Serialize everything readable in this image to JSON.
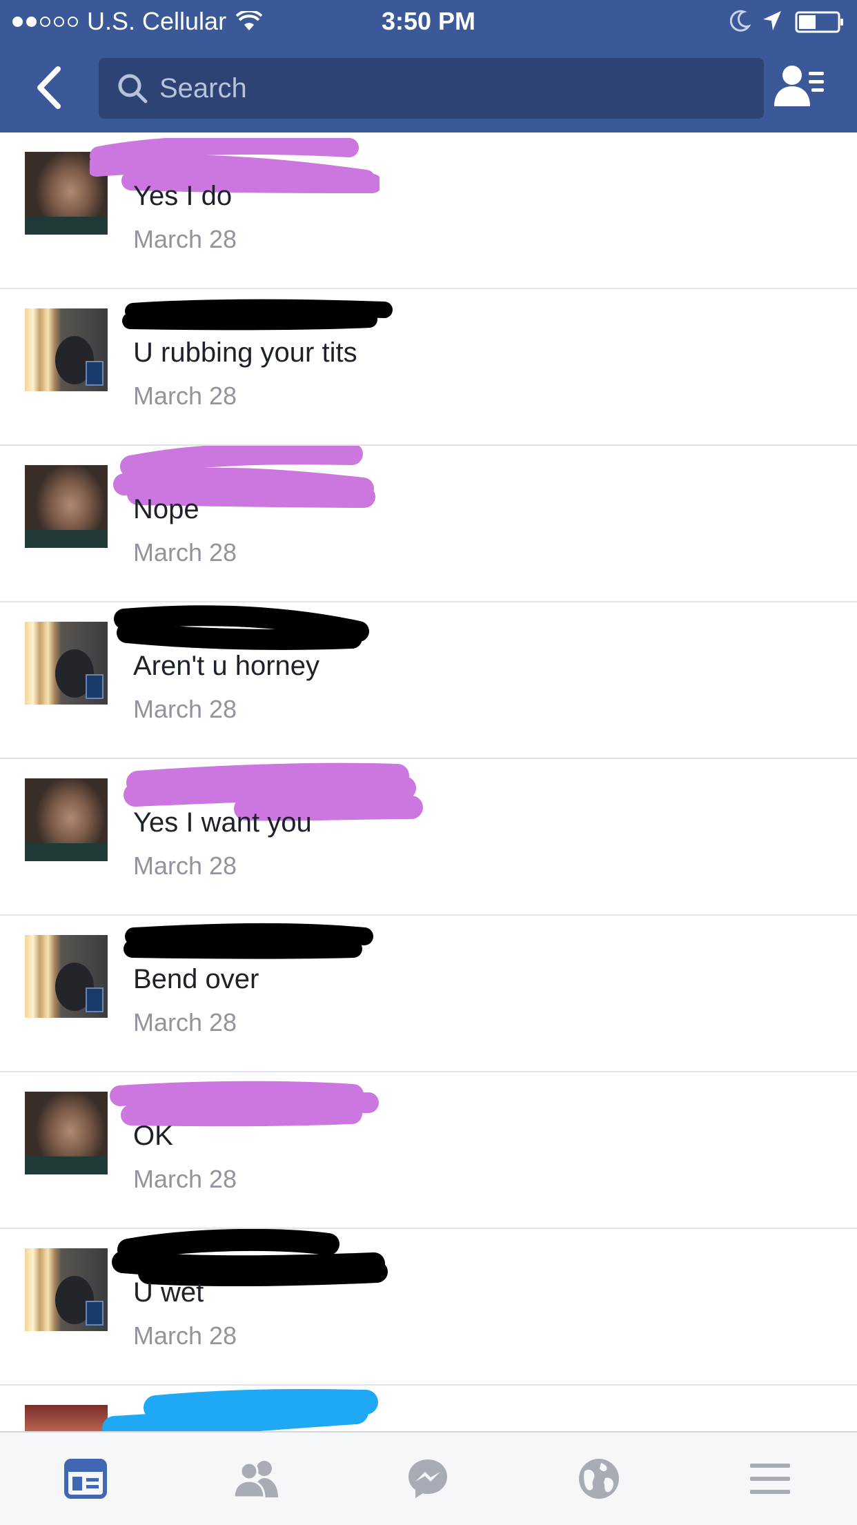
{
  "status_bar": {
    "carrier": "U.S. Cellular",
    "time": "3:50 PM",
    "signal_bars_filled": 2,
    "signal_bars_total": 5,
    "battery_level": 0.45
  },
  "nav": {
    "back_icon": "chevron-left-icon",
    "search_placeholder": "Search",
    "search_value": "",
    "right_icon": "friends-settings-icon"
  },
  "results": [
    {
      "avatar": "woman",
      "message": "Yes I do",
      "date": "March 28",
      "redaction_color": "#cc77e0"
    },
    {
      "avatar": "man",
      "message": "U rubbing your tits",
      "date": "March 28",
      "redaction_color": "#000000"
    },
    {
      "avatar": "woman",
      "message": "Nope",
      "date": "March 28",
      "redaction_color": "#cc77e0"
    },
    {
      "avatar": "man",
      "message": "Aren't u horney",
      "date": "March 28",
      "redaction_color": "#000000"
    },
    {
      "avatar": "woman",
      "message": "Yes I want you",
      "date": "March 28",
      "redaction_color": "#cc77e0"
    },
    {
      "avatar": "man",
      "message": "Bend over",
      "date": "March 28",
      "redaction_color": "#000000"
    },
    {
      "avatar": "woman",
      "message": "OK",
      "date": "March 28",
      "redaction_color": "#cc77e0"
    },
    {
      "avatar": "man",
      "message": "U wet",
      "date": "March 28",
      "redaction_color": "#000000"
    },
    {
      "avatar": "group",
      "message": "",
      "date": "",
      "redaction_color": "#1fa9f4"
    }
  ],
  "tab_bar": {
    "active_color": "#4267b2",
    "inactive_color": "#a8adb5",
    "tabs": [
      {
        "icon": "news-feed-icon",
        "active": true
      },
      {
        "icon": "friend-requests-icon",
        "active": false
      },
      {
        "icon": "messenger-icon",
        "active": false
      },
      {
        "icon": "notifications-globe-icon",
        "active": false
      },
      {
        "icon": "menu-icon",
        "active": false
      }
    ]
  }
}
